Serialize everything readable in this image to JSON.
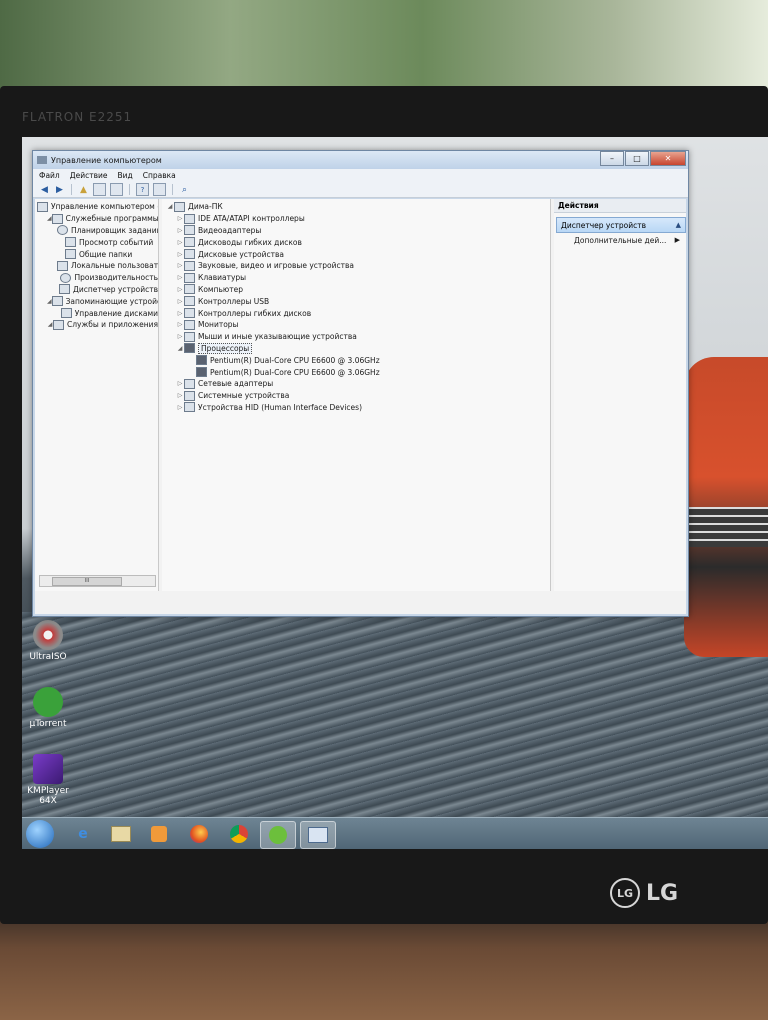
{
  "monitor": {
    "brand": "FLATRON E2251",
    "logo": "LG"
  },
  "window": {
    "title": "Управление компьютером",
    "menu": [
      "Файл",
      "Действие",
      "Вид",
      "Справка"
    ]
  },
  "left_tree": [
    {
      "label": "Управление компьютером (л",
      "indent": 0
    },
    {
      "label": "Служебные программы",
      "indent": 1
    },
    {
      "label": "Планировщик заданий",
      "indent": 2
    },
    {
      "label": "Просмотр событий",
      "indent": 2
    },
    {
      "label": "Общие папки",
      "indent": 2
    },
    {
      "label": "Локальные пользовате",
      "indent": 2
    },
    {
      "label": "Производительность",
      "indent": 2
    },
    {
      "label": "Диспетчер устройств",
      "indent": 2
    },
    {
      "label": "Запоминающие устройств",
      "indent": 1
    },
    {
      "label": "Управление дисками",
      "indent": 2
    },
    {
      "label": "Службы и приложения",
      "indent": 1
    }
  ],
  "left_scroll_label": "III",
  "device_tree": {
    "root": "Дима-ПК",
    "categories": [
      "IDE ATA/ATAPI контроллеры",
      "Видеоадаптеры",
      "Дисководы гибких дисков",
      "Дисковые устройства",
      "Звуковые, видео и игровые устройства",
      "Клавиатуры",
      "Компьютер",
      "Контроллеры USB",
      "Контроллеры гибких дисков",
      "Мониторы",
      "Мыши и иные указывающие устройства",
      "Процессоры"
    ],
    "processors": [
      "Pentium(R) Dual-Core  CPU      E6600  @ 3.06GHz",
      "Pentium(R) Dual-Core  CPU      E6600  @ 3.06GHz"
    ],
    "after": [
      "Сетевые адаптеры",
      "Системные устройства",
      "Устройства HID (Human Interface Devices)"
    ]
  },
  "actions": {
    "header": "Действия",
    "selected": "Диспетчер устройств",
    "more": "Дополнительные дей..."
  },
  "desktop_icons": [
    "UltraISO",
    "µTorrent",
    "KMPlayer 64X"
  ]
}
